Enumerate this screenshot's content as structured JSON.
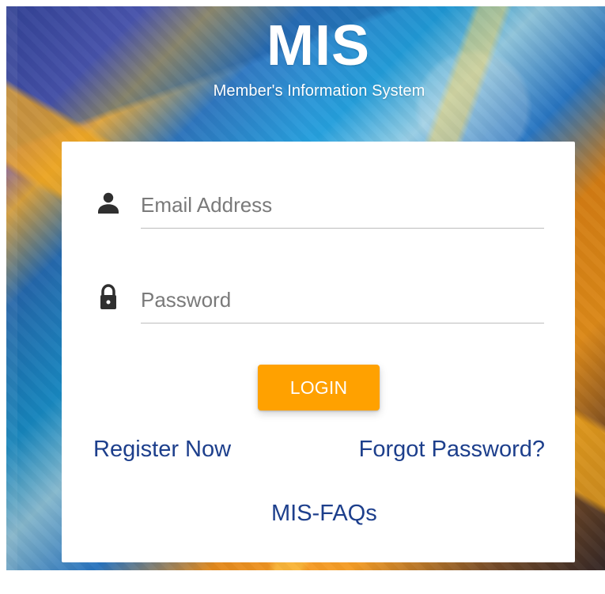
{
  "header": {
    "title": "MIS",
    "subtitle": "Member's Information System"
  },
  "login_form": {
    "email_placeholder": "Email Address",
    "password_placeholder": "Password",
    "login_label": "LOGIN",
    "register_link": "Register Now",
    "forgot_link": "Forgot Password?",
    "faq_link": "MIS-FAQs",
    "icons": {
      "email_icon": "user-icon",
      "password_icon": "lock-icon"
    },
    "colors": {
      "login_button": "#ffa100",
      "links": "#1d3f8c"
    }
  }
}
